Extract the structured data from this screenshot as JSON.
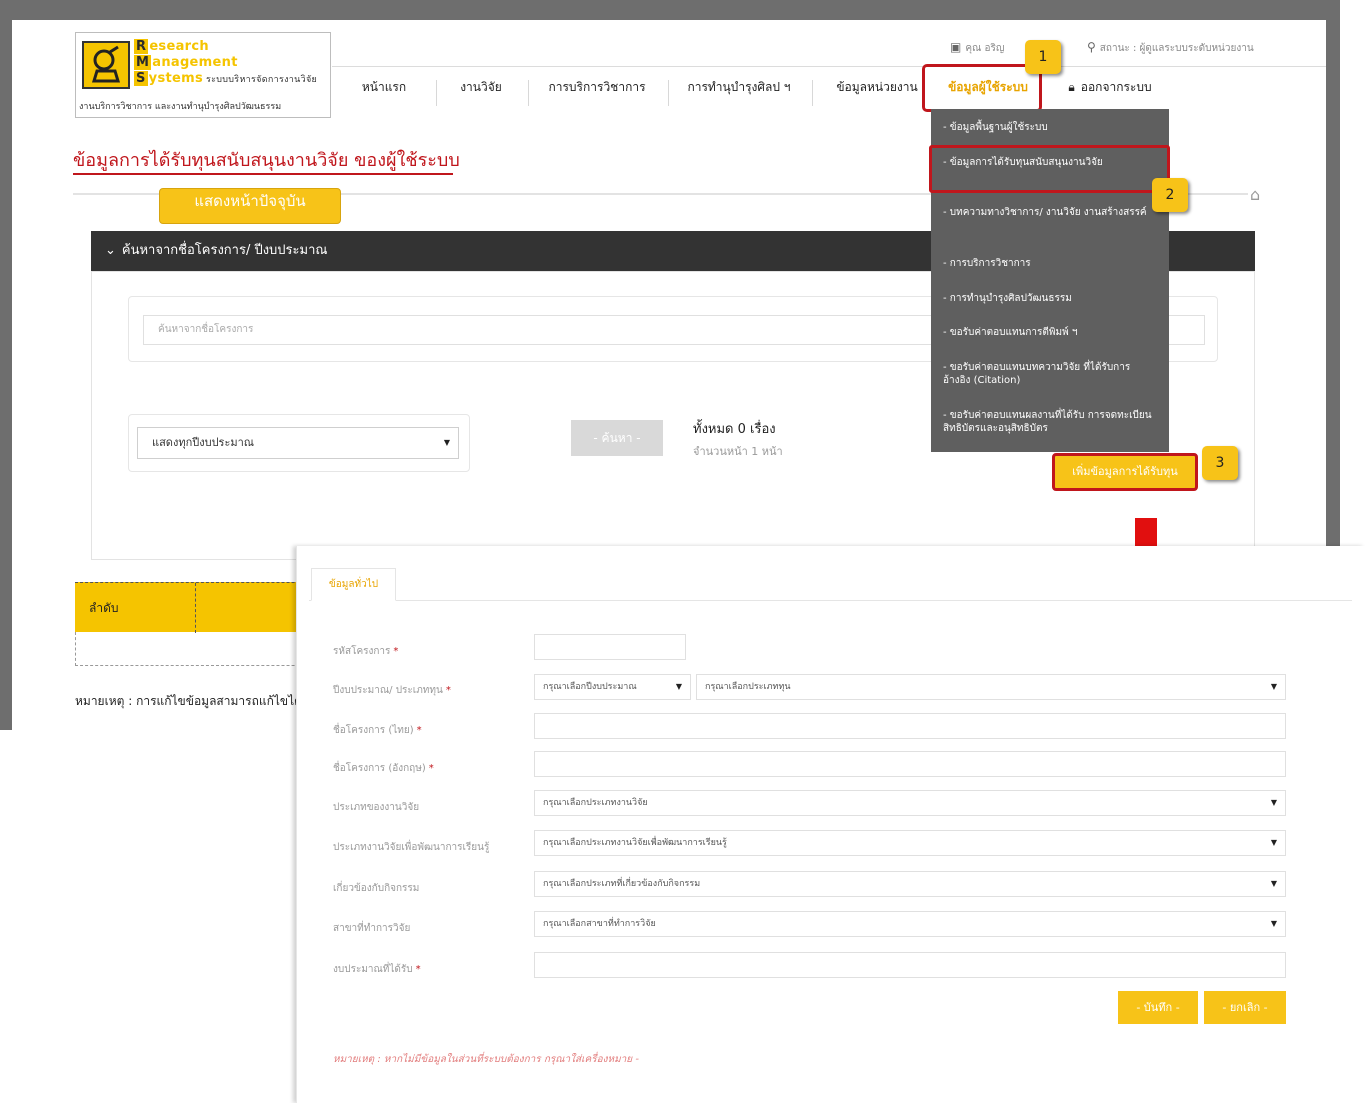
{
  "logo": {
    "r_letter": "R",
    "r_text": "esearch",
    "m_letter": "M",
    "m_text": "anagement",
    "s_letter": "S",
    "s_text": "ystems",
    "s_sub": "ระบบบริหารจัดการงานวิจัย",
    "footer": "งานบริการวิชาการ และงานทำนุบำรุงศิลปวัฒนธรรม"
  },
  "top_util": {
    "user_icon": "calendar-icon",
    "user_text": "คุณ อริญ",
    "status_icon": "pin-icon",
    "status_text": "สถานะ : ผู้ดูแลระบบระดับหน่วยงาน"
  },
  "nav": {
    "home": "หน้าแรก",
    "research": "งานวิจัย",
    "academic_service": "การบริการวิชาการ",
    "arts": "การทำนุบำรุงศิลป ฯ",
    "unit_info": "ข้อมูลหน่วยงาน",
    "user_info": "ข้อมูลผู้ใช้ระบบ",
    "logout_icon": "lock-icon",
    "logout": "ออกจากระบบ"
  },
  "dropdown": {
    "items": [
      "- ข้อมูลพื้นฐานผู้ใช้ระบบ",
      "- ข้อมูลการได้รับทุนสนับสนุนงานวิจัย",
      "- บทความทางวิชาการ/ งานวิจัย งานสร้างสรรค์",
      "- การบริการวิชาการ",
      "- การทำนุบำรุงศิลปวัฒนธรรม",
      "- ขอรับค่าตอบแทนการตีพิมพ์ ฯ",
      "- ขอรับค่าตอบแทนบทความวิจัย ที่ได้รับการอ้างอิง (Citation)",
      "- ขอรับค่าตอบแทนผลงานที่ได้รับ การจดทะเบียนสิทธิบัตรและอนุสิทธิบัตร"
    ]
  },
  "page": {
    "title": "ข้อมูลการได้รับทุนสนับสนุนงานวิจัย ของผู้ใช้ระบบ",
    "show_current": "แสดงหน้าปัจจุบัน",
    "home_icon": "home-icon"
  },
  "search": {
    "header": "ค้นหาจากชื่อโครงการ/ ปีงบประมาณ",
    "header_icon": "chevron-down-icon",
    "placeholder": "ค้นหาจากชื่อโครงการ",
    "year_select": "แสดงทุกปีงบประมาณ",
    "button": "- ค้นหา -",
    "count": "ทั้งหมด 0 เรื่อง",
    "pages": "จำนวนหน้า 1 หน้า"
  },
  "add_button": "เพิ่มข้อมูลการได้รับทุน",
  "table": {
    "columns": [
      "ลำดับ"
    ]
  },
  "note_bg": "หมายเหตุ : การแก้ไขข้อมูลสามารถแก้ไขได้เฉพ",
  "steps": [
    "1",
    "2",
    "3"
  ],
  "form": {
    "tab": "ข้อมูลทั่วไป",
    "fields": {
      "project_code": {
        "label": "รหัสโครงการ",
        "required": "*"
      },
      "budget_year_type": {
        "label": "ปีงบประมาณ/ ประเภททุน",
        "required": "*",
        "year_value": "กรุณาเลือกปีงบประมาณ",
        "type_value": "กรุณาเลือกประเภททุน"
      },
      "name_th": {
        "label": "ชื่อโครงการ (ไทย)",
        "required": "*"
      },
      "name_en": {
        "label": "ชื่อโครงการ (อังกฤษ)",
        "required": "*"
      },
      "research_type": {
        "label": "ประเภทของงานวิจัย",
        "value": "กรุณาเลือกประเภทงานวิจัย"
      },
      "learning_type": {
        "label": "ประเภทงานวิจัยเพื่อพัฒนาการเรียนรู้",
        "value": "กรุณาเลือกประเภทงานวิจัยเพื่อพัฒนาการเรียนรู้"
      },
      "activity_type": {
        "label": "เกี่ยวข้องกับกิจกรรม",
        "value": "กรุณาเลือกประเภทที่เกี่ยวข้องกับกิจกรรม"
      },
      "branch": {
        "label": "สาขาที่ทำการวิจัย",
        "value": "กรุณาเลือกสาขาที่ทำการวิจัย"
      },
      "budget": {
        "label": "งบประมาณที่ได้รับ",
        "required": "*"
      }
    },
    "save": "- บันทึก -",
    "cancel": "- ยกเลิก -",
    "note": "หมายเหตุ : หากไม่มีข้อมูลในส่วนที่ระบบต้องการ กรุณาใส่เครื่องหมาย -"
  },
  "colors": {
    "accent_yellow": "#f7c318",
    "highlight_red": "#c0161c",
    "header_dark": "#333333",
    "menu_gray": "#5f5f5f"
  }
}
